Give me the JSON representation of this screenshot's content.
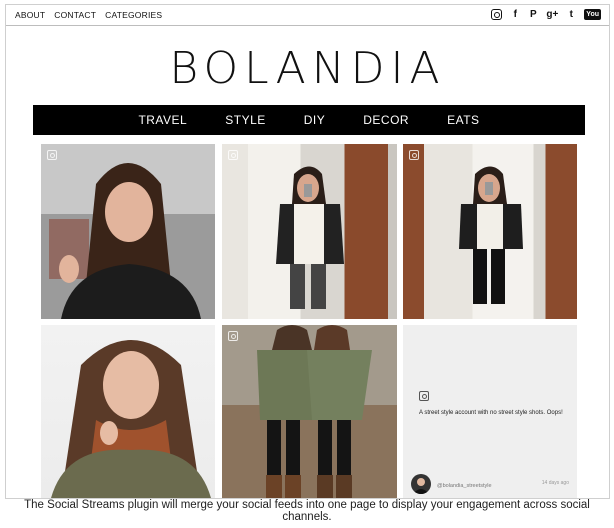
{
  "top_links": [
    "ABOUT",
    "CONTACT",
    "CATEGORIES"
  ],
  "social_icons": [
    "instagram-icon",
    "facebook-icon",
    "pinterest-icon",
    "google-plus-icon",
    "twitter-icon",
    "youtube-icon"
  ],
  "social_glyphs": {
    "facebook": "f",
    "pinterest": "P",
    "googleplus": "g+",
    "twitter": "t",
    "youtube": "You"
  },
  "logo": "BOLANDIA",
  "nav": [
    "TRAVEL",
    "STYLE",
    "DIY",
    "DECOR",
    "EATS"
  ],
  "post": {
    "text": "A street style account with no street style shots. Oops!",
    "handle": "@bolandia_streetstyle",
    "date": "14 days ago"
  },
  "caption": "The Social Streams plugin will merge your social feeds into one page to display your engagement across social channels.",
  "colors": {
    "nav_bg": "#000000",
    "nav_text": "#ffffff",
    "page_bg": "#ffffff"
  }
}
